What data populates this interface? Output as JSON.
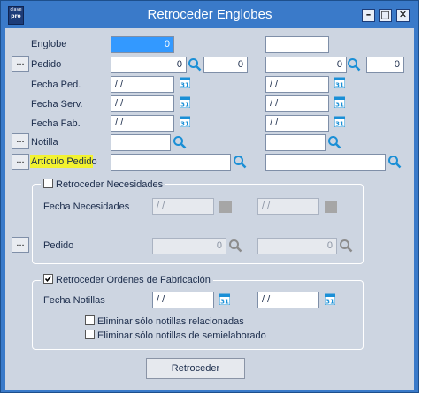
{
  "window": {
    "title": "Retroceder Englobes",
    "logo_top": "clave",
    "logo_bottom": "pro"
  },
  "controls": {
    "minimize": "–",
    "maximize": "□",
    "close": "✕"
  },
  "form": {
    "englobe": {
      "label": "Englobe",
      "value1": "0",
      "value2": ""
    },
    "pedido": {
      "label": "Pedido",
      "from_num": "0",
      "from_line": "0",
      "to_num": "0",
      "to_line": "0"
    },
    "fecha_ped": {
      "label": "Fecha Ped.",
      "from": " / /",
      "to": " / /"
    },
    "fecha_serv": {
      "label": "Fecha Serv.",
      "from": " / /",
      "to": " / /"
    },
    "fecha_fab": {
      "label": "Fecha Fab.",
      "from": " / /",
      "to": " / /"
    },
    "notilla": {
      "label": "Notilla",
      "from": "",
      "to": ""
    },
    "articulo_pedido": {
      "label": "Artículo Pedido",
      "from": "",
      "to": ""
    },
    "dots_label": "..."
  },
  "necesidades": {
    "title": "Retroceder Necesidades",
    "checked": false,
    "fecha_label": "Fecha Necesidades",
    "fecha_from": " / /",
    "fecha_to": " / /",
    "pedido_label": "Pedido",
    "pedido_from": "0",
    "pedido_to": "0"
  },
  "ordenes": {
    "title": "Retroceder Ordenes de Fabricación",
    "checked": true,
    "fecha_label": "Fecha Notillas",
    "fecha_from": " / /",
    "fecha_to": " / /",
    "opt1": "Eliminar sólo notillas relacionadas",
    "opt2": "Eliminar sólo notillas de semielaborado"
  },
  "actions": {
    "retroceder": "Retroceder"
  },
  "calendar_day": "31",
  "colors": {
    "titlebar": "#3a7ac9",
    "panel": "#cdd5e1",
    "highlight": "#f2f230",
    "selection": "#3399ff",
    "icon": "#1a8fd6"
  }
}
